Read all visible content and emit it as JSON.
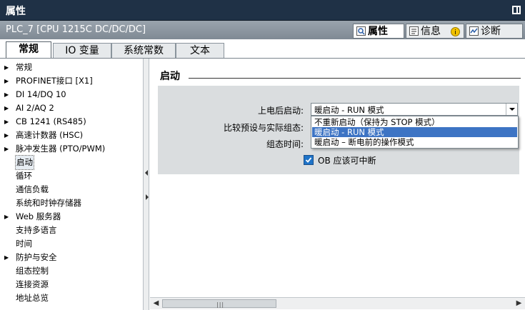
{
  "window": {
    "title": "属性"
  },
  "device": {
    "name": "PLC_7 [CPU 1215C DC/DC/DC]"
  },
  "panel_tabs": [
    {
      "label": "属性",
      "icon": "properties-icon"
    },
    {
      "label": "信息",
      "icon": "info-icon"
    },
    {
      "label": "诊断",
      "icon": "diagnostics-icon"
    }
  ],
  "tabs": [
    {
      "label": "常规"
    },
    {
      "label": "IO 变量"
    },
    {
      "label": "系统常数"
    },
    {
      "label": "文本"
    }
  ],
  "nav": {
    "items": [
      {
        "label": "常规",
        "expandable": true
      },
      {
        "label": "PROFINET接口 [X1]",
        "expandable": true
      },
      {
        "label": "DI 14/DQ 10",
        "expandable": true
      },
      {
        "label": "AI 2/AQ 2",
        "expandable": true
      },
      {
        "label": "CB 1241 (RS485)",
        "expandable": true
      },
      {
        "label": "高速计数器 (HSC)",
        "expandable": true
      },
      {
        "label": "脉冲发生器 (PTO/PWM)",
        "expandable": true
      },
      {
        "label": "启动",
        "expandable": false,
        "selected": true
      },
      {
        "label": "循环",
        "expandable": false
      },
      {
        "label": "通信负载",
        "expandable": false
      },
      {
        "label": "系统和时钟存储器",
        "expandable": false
      },
      {
        "label": "Web 服务器",
        "expandable": true
      },
      {
        "label": "支持多语言",
        "expandable": false
      },
      {
        "label": "时间",
        "expandable": false
      },
      {
        "label": "防护与安全",
        "expandable": true
      },
      {
        "label": "组态控制",
        "expandable": false
      },
      {
        "label": "连接资源",
        "expandable": false
      },
      {
        "label": "地址总览",
        "expandable": false
      }
    ]
  },
  "section": {
    "title": "启动"
  },
  "form": {
    "startup_label": "上电后启动:",
    "startup_value": "暖启动 - RUN 模式",
    "compare_label": "比较预设与实际组态:",
    "config_time_label": "组态时间:",
    "options": [
      "不重新启动（保持为 STOP 模式）",
      "暖启动 - RUN 模式",
      "暖启动 – 断电前的操作模式"
    ],
    "selected_option_index": 1,
    "ob_checkbox_label": "OB 应该可中断",
    "ob_checkbox_checked": true
  },
  "colors": {
    "titlebar": "#1f3146",
    "subbar": "#8a949d",
    "panel_bg": "#dadddf",
    "selection": "#3d74c4",
    "checkbox": "#1e73c8"
  }
}
